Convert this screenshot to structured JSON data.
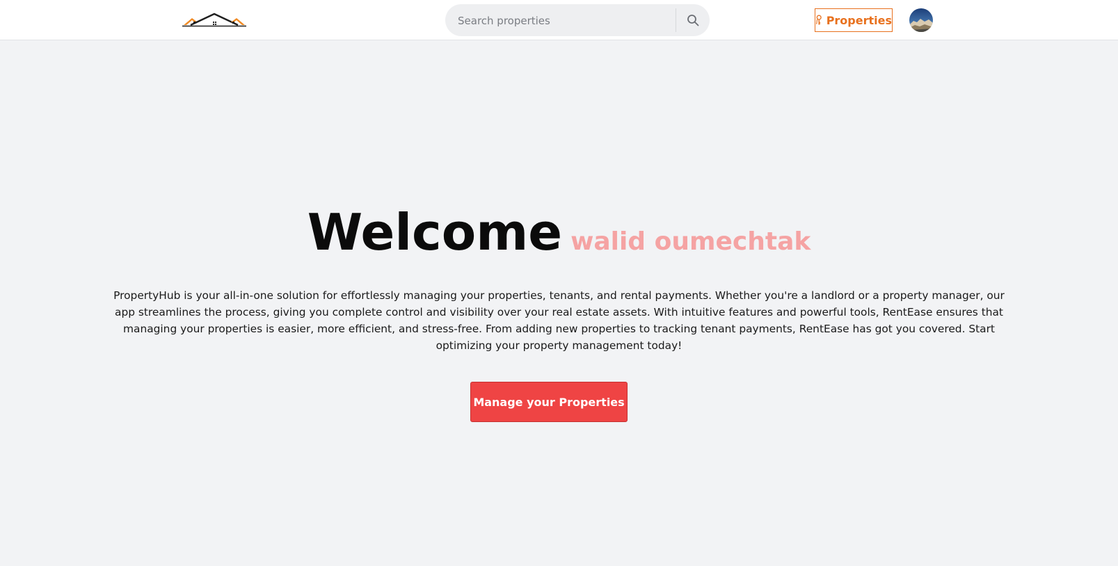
{
  "header": {
    "logo_icon": "house-roofs-logo-icon",
    "search": {
      "placeholder": "Search properties",
      "value": "",
      "icon": "search-icon"
    },
    "properties_button": {
      "label": "Properties",
      "icon": "keys-icon",
      "color": "#e8711e"
    },
    "avatar_icon": "user-avatar"
  },
  "hero": {
    "welcome": "Welcome",
    "username": "walid oumechtak",
    "description": "PropertyHub is your all-in-one solution for effortlessly managing your properties, tenants, and rental payments. Whether you're a landlord or a property manager, our app streamlines the process, giving you complete control and visibility over your real estate assets. With intuitive features and powerful tools, RentEase ensures that managing your properties is easier, more efficient, and stress-free. From adding new properties to tracking tenant payments, RentEase has got you covered. Start optimizing your property management today!",
    "cta_label": "Manage your Properties"
  },
  "colors": {
    "accent_orange": "#e8711e",
    "cta_red": "#ef4444",
    "username_pink": "#f5a3a3",
    "page_bg": "#f2f3f5"
  }
}
